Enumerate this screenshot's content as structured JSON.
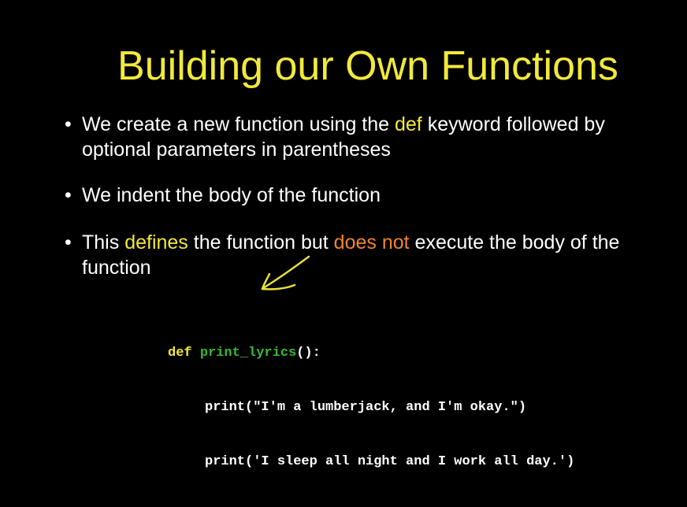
{
  "slide": {
    "title": "Building our Own Functions",
    "bullets": [
      {
        "dot": "•",
        "pre": "We create a new function using the ",
        "kw": "def",
        "post": " keyword followed by optional parameters in parentheses"
      },
      {
        "dot": "•",
        "text": "We indent the body of the function"
      },
      {
        "dot": "•",
        "pre": "This ",
        "kw1": "defines",
        "mid": " the function but ",
        "kw2": "does not",
        "post": " execute the body of the function"
      }
    ],
    "code": {
      "def_kw": "def",
      "fn_name": "print_lyrics",
      "sig_rest": "():",
      "line2": "print(\"I'm a lumberjack, and I'm okay.\")",
      "line3": "print('I sleep all night and I work all day.')"
    },
    "colors": {
      "background": "#000000",
      "title": "#f2e93a",
      "keyword_yellow": "#f2e93a",
      "keyword_orange": "#f0852a",
      "function_name": "#3ab934",
      "annotation_pen": "#e6e23a"
    },
    "annotation": "pen-arrow"
  }
}
